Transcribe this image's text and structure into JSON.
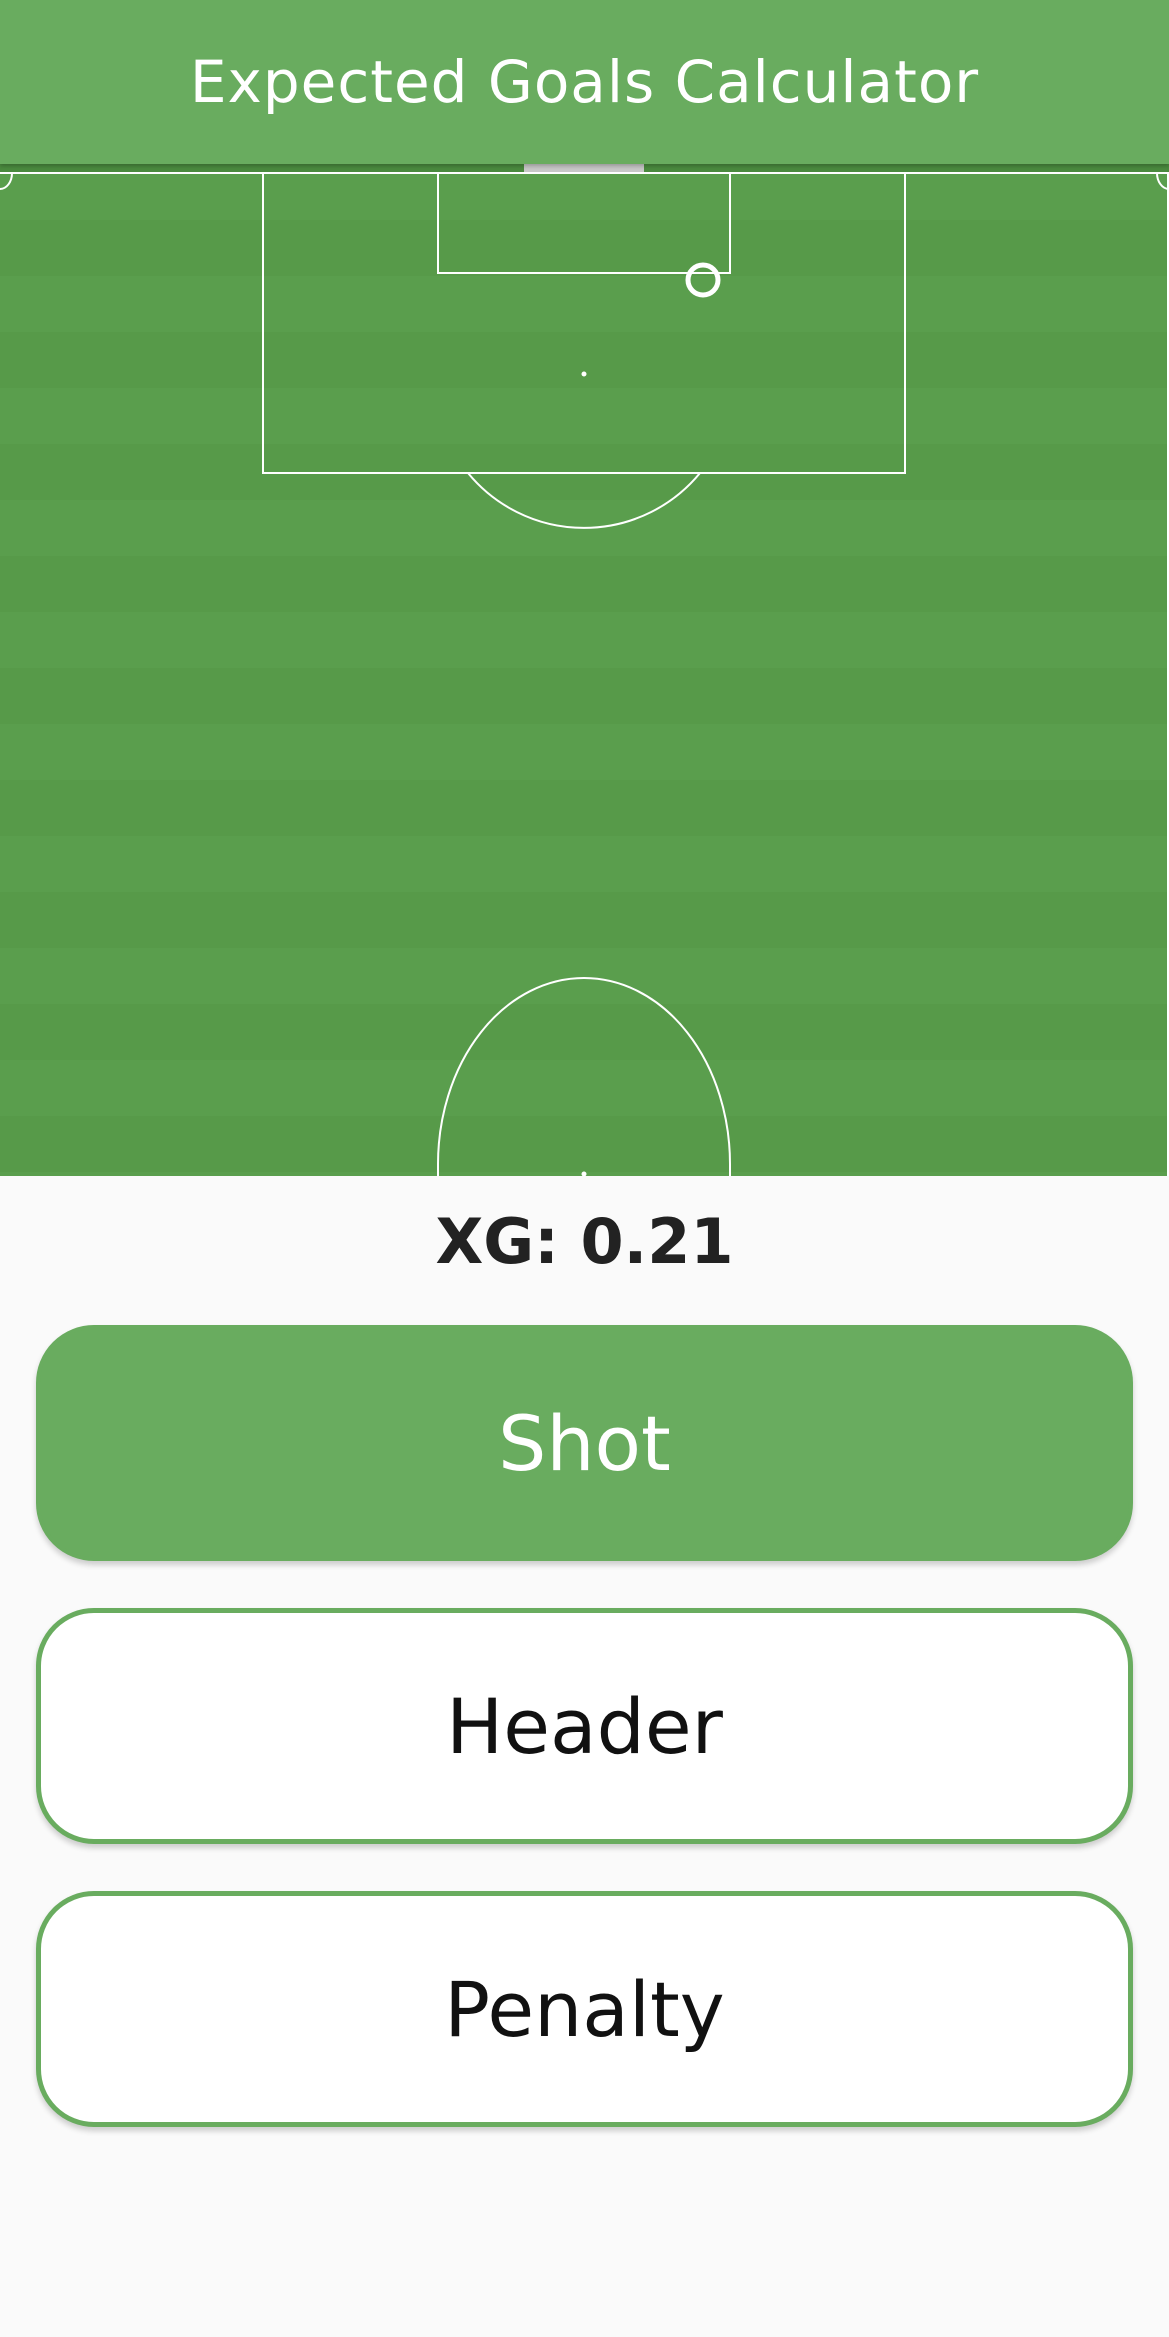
{
  "app": {
    "title": "Expected Goals Calculator"
  },
  "pitch": {
    "stripe_colors": [
      "#5a9e4d",
      "#579a49"
    ],
    "line_color": "#ffffff",
    "goal_color": "#c8c8c8",
    "top_band_color": "#4a8a3e"
  },
  "result": {
    "text": "XG: 0.21",
    "value": 0.21
  },
  "shot_types": {
    "selected": "Shot",
    "options": [
      {
        "id": "shot",
        "label": "Shot",
        "selected": true
      },
      {
        "id": "header",
        "label": "Header",
        "selected": false
      },
      {
        "id": "penalty",
        "label": "Penalty",
        "selected": false
      }
    ]
  },
  "colors": {
    "primary": "#69ac5f",
    "background": "#fafafa",
    "button_unselected_bg": "#ffffff",
    "text_dark": "#222222"
  }
}
